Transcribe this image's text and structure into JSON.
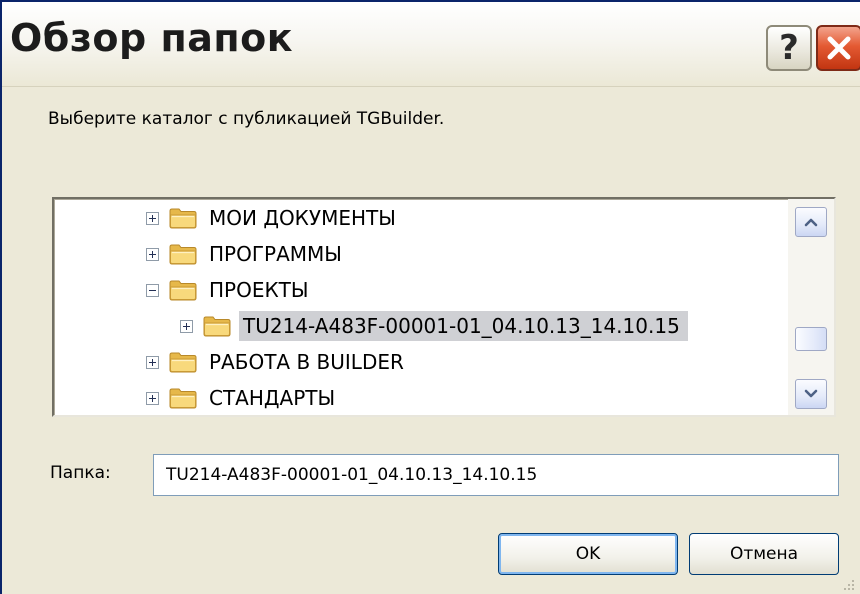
{
  "window": {
    "title": "Обзор папок"
  },
  "titlebar": {
    "help_label": "?",
    "close_icon": "close-icon"
  },
  "prompt": "Выберите каталог с публикацией TGBuilder.",
  "tree": {
    "items": [
      {
        "label": "МОИ ДОКУМЕНТЫ",
        "expander": "plus",
        "level": 0,
        "selected": false
      },
      {
        "label": "ПРОГРАММЫ",
        "expander": "plus",
        "level": 0,
        "selected": false
      },
      {
        "label": "ПРОЕКТЫ",
        "expander": "minus",
        "level": 0,
        "selected": false
      },
      {
        "label": "TU214-A483F-00001-01_04.10.13_14.10.15",
        "expander": "plus",
        "level": 1,
        "selected": true
      },
      {
        "label": "РАБОТА В BUILDER",
        "expander": "plus",
        "level": 0,
        "selected": false
      },
      {
        "label": "СТАНДАРТЫ",
        "expander": "plus",
        "level": 0,
        "selected": false
      }
    ]
  },
  "folder": {
    "label": "Папка:",
    "value": "TU214-A483F-00001-01_04.10.13_14.10.15"
  },
  "buttons": {
    "ok": "OK",
    "cancel": "Отмена"
  },
  "colors": {
    "dialog_bg": "#ece9d8",
    "selection": "#cfd0d4",
    "close_red": "#e45a33",
    "folder_yellow": "#f5d16e"
  }
}
